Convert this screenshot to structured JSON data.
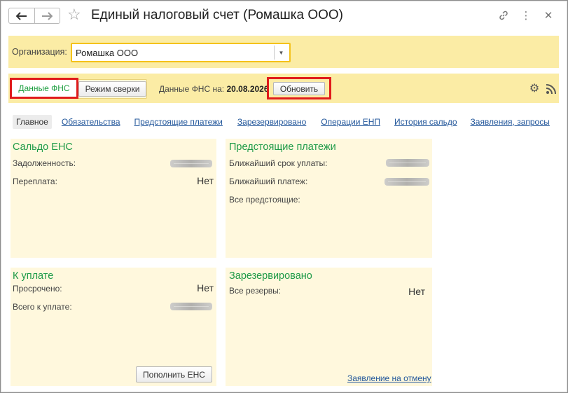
{
  "window": {
    "title": "Единый налоговый счет (Ромашка ООО)",
    "back_icon": "arrow-left-icon",
    "forward_icon": "arrow-right-icon",
    "favorite_icon": "star-icon",
    "link_icon": "link-icon",
    "menu_icon": "more-vertical-icon",
    "close_icon": "close-icon"
  },
  "organization": {
    "label": "Организация:",
    "value": "Ромашка ООО"
  },
  "toolbar": {
    "segment_fns": "Данные ФНС",
    "segment_reconcile": "Режим сверки",
    "fns_date_label": "Данные ФНС на:",
    "fns_date_value": "20.08.2026",
    "refresh_label": "Обновить",
    "settings_icon": "gear-icon",
    "rss_icon": "rss-icon"
  },
  "tabs": [
    {
      "label": "Главное",
      "active": true
    },
    {
      "label": "Обязательства",
      "active": false
    },
    {
      "label": "Предстоящие платежи",
      "active": false
    },
    {
      "label": "Зарезервировано",
      "active": false
    },
    {
      "label": "Операции ЕНП",
      "active": false
    },
    {
      "label": "История сальдо",
      "active": false
    },
    {
      "label": "Заявления, запросы",
      "active": false
    }
  ],
  "cards": {
    "saldo": {
      "title": "Сальдо ЕНС",
      "debt_label": "Задолженность:",
      "overpay_label": "Переплата:",
      "overpay_value": "Нет"
    },
    "upcoming": {
      "title": "Предстоящие платежи",
      "nearest_due_label": "Ближайший срок уплаты:",
      "nearest_payment_label": "Ближайший платеж:",
      "all_upcoming_label": "Все предстоящие:"
    },
    "to_pay": {
      "title": "К уплате",
      "overdue_label": "Просрочено:",
      "overdue_value": "Нет",
      "total_label": "Всего к уплате:",
      "topup_button": "Пополнить ЕНС"
    },
    "reserved": {
      "title": "Зарезервировано",
      "all_reserves_label": "Все резервы:",
      "all_reserves_value": "Нет",
      "cancel_link": "Заявление на отмену"
    }
  },
  "colors": {
    "accent_yellow": "#fbeca5",
    "card_bg": "#fff8dd",
    "title_green": "#1e9a48",
    "link_blue": "#23579b",
    "highlight_red": "#e01b1b"
  }
}
